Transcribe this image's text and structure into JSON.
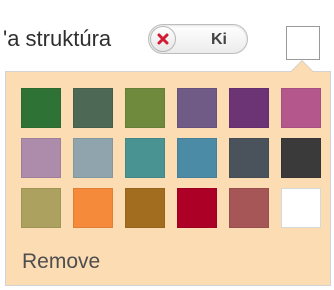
{
  "header": {
    "structure_label": "'a struktúra",
    "toggle": {
      "state_label": "Ki",
      "icon": "close-icon"
    },
    "selected_color": "#ffffff"
  },
  "palette": {
    "background": "#fcdcb3",
    "swatches": [
      "#2f7236",
      "#4d6854",
      "#6f8a3d",
      "#705a86",
      "#6d3475",
      "#b3578d",
      "#ad8baa",
      "#8fa4ac",
      "#4a9393",
      "#4b8ba5",
      "#4a535c",
      "#3a3a3a",
      "#ada160",
      "#f48a3a",
      "#a36d20",
      "#ad0027",
      "#a65656",
      "#ffffff"
    ],
    "remove_label": "Remove"
  }
}
